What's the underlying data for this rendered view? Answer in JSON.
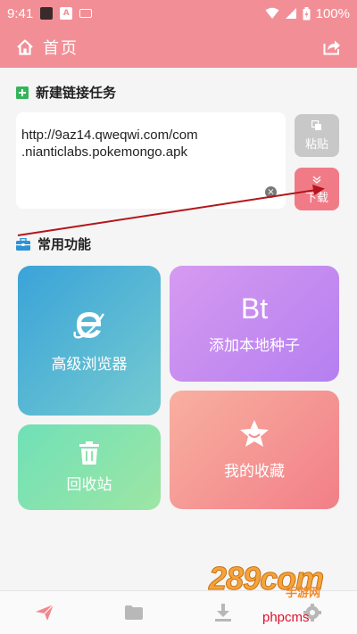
{
  "status_bar": {
    "time": "9:41",
    "battery": "100%"
  },
  "app_bar": {
    "title": "首页"
  },
  "new_task": {
    "heading": "新建链接任务",
    "url_line1": "http://9az14.qweqwi.com/com",
    "url_line2": ".nianticlabs.pokemongo.apk",
    "paste_label": "粘贴",
    "download_label": "下载"
  },
  "functions": {
    "heading": "常用功能",
    "browser_label": "高级浏览器",
    "torrent_icon_text": "Bt",
    "torrent_label": "添加本地种子",
    "recycle_label": "回收站",
    "favorites_label": "我的收藏"
  },
  "bottom_nav": {
    "items": [
      "send-icon",
      "folder-icon",
      "download-icon",
      "settings-icon"
    ]
  },
  "watermark": {
    "logo": "289com",
    "sub": "手游网",
    "site": "phpcms"
  },
  "colors": {
    "accent": "#f28f96",
    "download_btn": "#f07b86",
    "paste_btn": "#c8c8c8",
    "annotation_arrow": "#b3161c"
  }
}
